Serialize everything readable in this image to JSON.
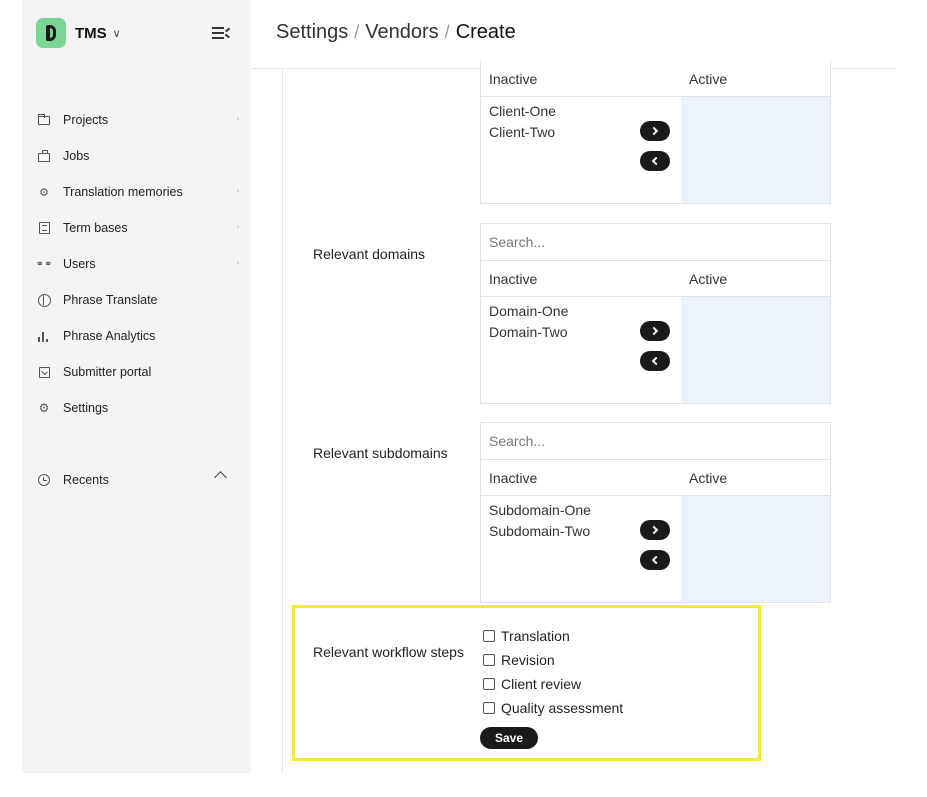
{
  "sidebar": {
    "brand": "TMS",
    "nav": [
      {
        "label": "Projects",
        "icon": "folder-icon"
      },
      {
        "label": "Jobs",
        "icon": "briefcase-icon"
      },
      {
        "label": "Translation memories",
        "icon": "memory-chip-icon"
      },
      {
        "label": "Term bases",
        "icon": "book-icon"
      },
      {
        "label": "Users",
        "icon": "users-icon"
      },
      {
        "label": "Phrase Translate",
        "icon": "globe-icon"
      },
      {
        "label": "Phrase Analytics",
        "icon": "bar-chart-icon"
      },
      {
        "label": "Submitter portal",
        "icon": "inbox-icon"
      },
      {
        "label": "Settings",
        "icon": "gear-icon"
      }
    ],
    "recents_label": "Recents"
  },
  "header": {
    "crumbs": [
      "Settings",
      "Vendors"
    ],
    "current": "Create",
    "separator": "/"
  },
  "clients": {
    "inactive_label": "Inactive",
    "active_label": "Active",
    "inactive_items": [
      "Client-One",
      "Client-Two"
    ]
  },
  "domains": {
    "label": "Relevant domains",
    "search_placeholder": "Search...",
    "inactive_label": "Inactive",
    "active_label": "Active",
    "inactive_items": [
      "Domain-One",
      "Domain-Two"
    ]
  },
  "subdomains": {
    "label": "Relevant subdomains",
    "search_placeholder": "Search...",
    "inactive_label": "Inactive",
    "active_label": "Active",
    "inactive_items": [
      "Subdomain-One",
      "Subdomain-Two"
    ]
  },
  "workflow": {
    "label": "Relevant workflow steps",
    "steps": [
      "Translation",
      "Revision",
      "Client review",
      "Quality assessment"
    ],
    "save_label": "Save"
  },
  "colors": {
    "highlight": "#f2ea3a",
    "logo": "#7ad695",
    "active_pane": "#edf3fb"
  }
}
